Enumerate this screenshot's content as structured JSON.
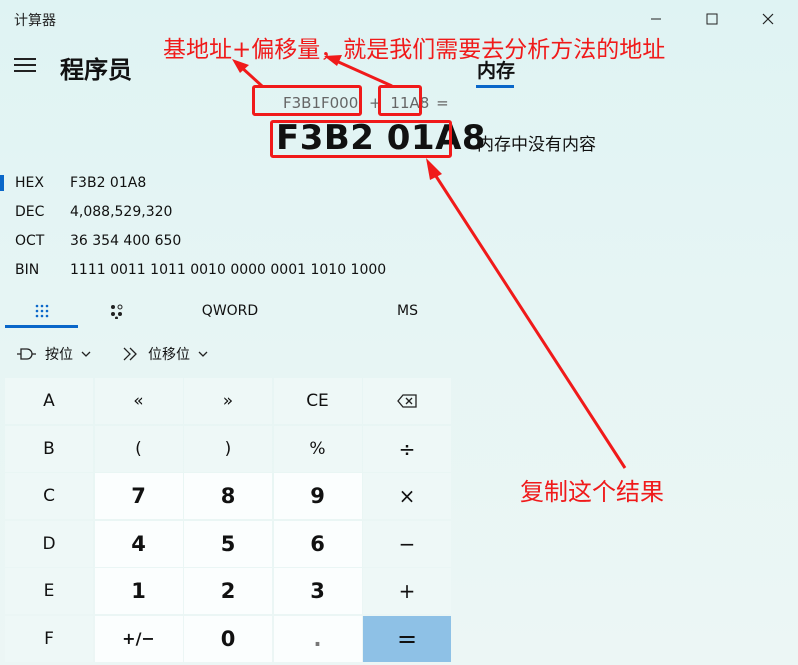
{
  "window": {
    "title": "计算器",
    "controls": [
      "minimize",
      "maximize",
      "close"
    ]
  },
  "header": {
    "mode_title": "程序员",
    "memory_tab": "内存",
    "memory_empty_text": "内存中没有内容"
  },
  "expression": {
    "base": "F3B1F000",
    "operator": "+",
    "offset": "11A8",
    "equals": "="
  },
  "result": "F3B2 01A8",
  "radix": [
    {
      "name": "HEX",
      "value": "F3B2 01A8"
    },
    {
      "name": "DEC",
      "value": "4,088,529,320"
    },
    {
      "name": "OCT",
      "value": "36 354 400 650"
    },
    {
      "name": "BIN",
      "value": "1111 0011 1011 0010 0000 0001 1010 1000"
    }
  ],
  "toolbar": {
    "word_size": "QWORD",
    "ms": "MS",
    "bitwise": "按位",
    "bitshift": "位移位"
  },
  "keys": [
    "A",
    "«",
    "»",
    "CE",
    "⌫",
    "B",
    "(",
    ")",
    "%",
    "÷",
    "C",
    "7",
    "8",
    "9",
    "×",
    "D",
    "4",
    "5",
    "6",
    "−",
    "E",
    "1",
    "2",
    "3",
    "+",
    "F",
    "+/−",
    "0",
    ".",
    "="
  ],
  "annotations": {
    "top_note": "基地址+偏移量，就是我们需要去分析方法的地址",
    "bottom_note": "复制这个结果",
    "color": "#f01a1a"
  },
  "colors": {
    "accent": "#0a67c9",
    "equals_key": "#8ec1e6",
    "annotation": "#f01a1a"
  }
}
